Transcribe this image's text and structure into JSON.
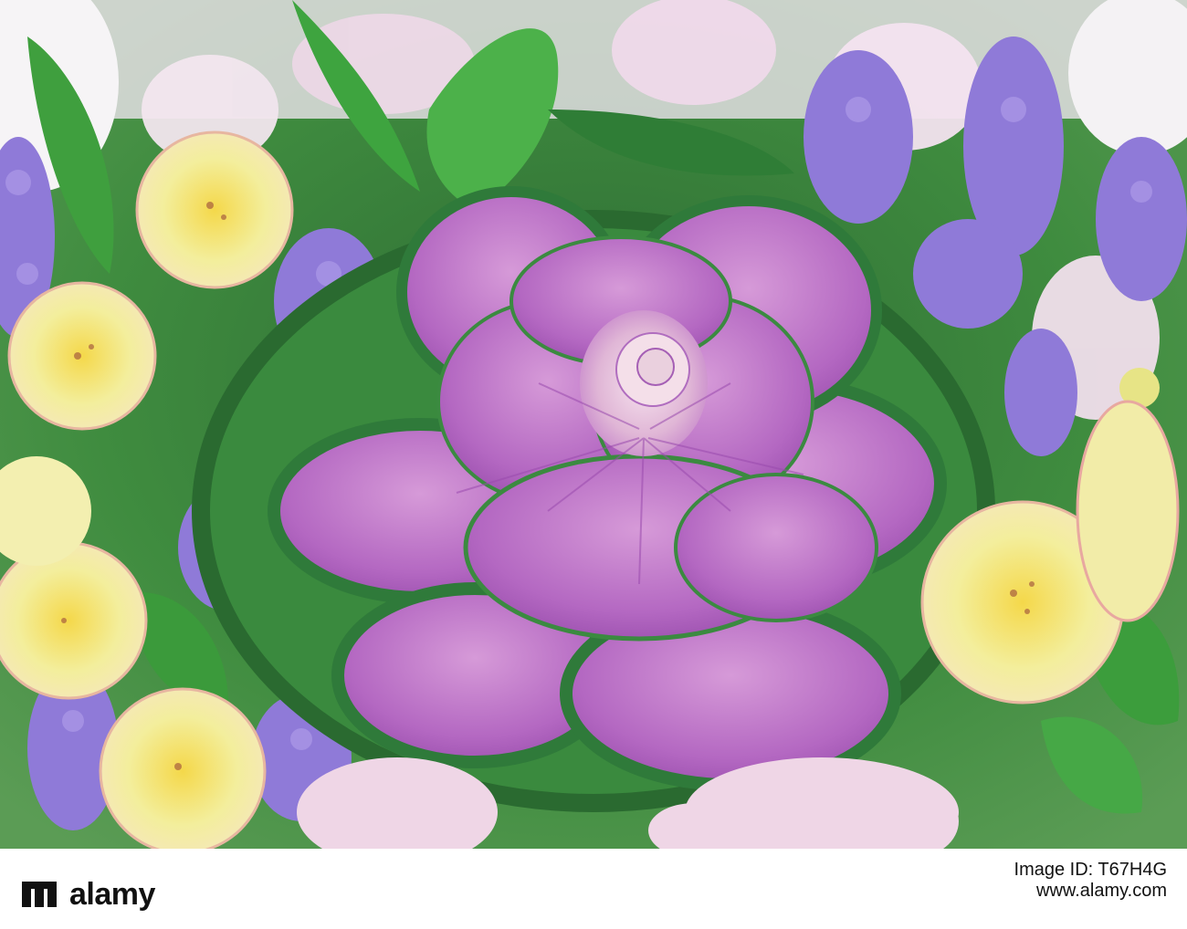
{
  "photo": {
    "subject": "ornamental-cabbage-bouquet",
    "colors": {
      "cabbage_purple": "#b86cc4",
      "cabbage_edge_green": "#2f7a3a",
      "leaf_green": "#3aa43a",
      "lavender": "#8f7ad8",
      "alstroemeria_yellow": "#f1ea8f",
      "daisy_pink": "#eed6e6"
    }
  },
  "footer": {
    "logo_text": "alamy",
    "line1": "Image ID: T67H4G",
    "line2": "www.alamy.com"
  }
}
